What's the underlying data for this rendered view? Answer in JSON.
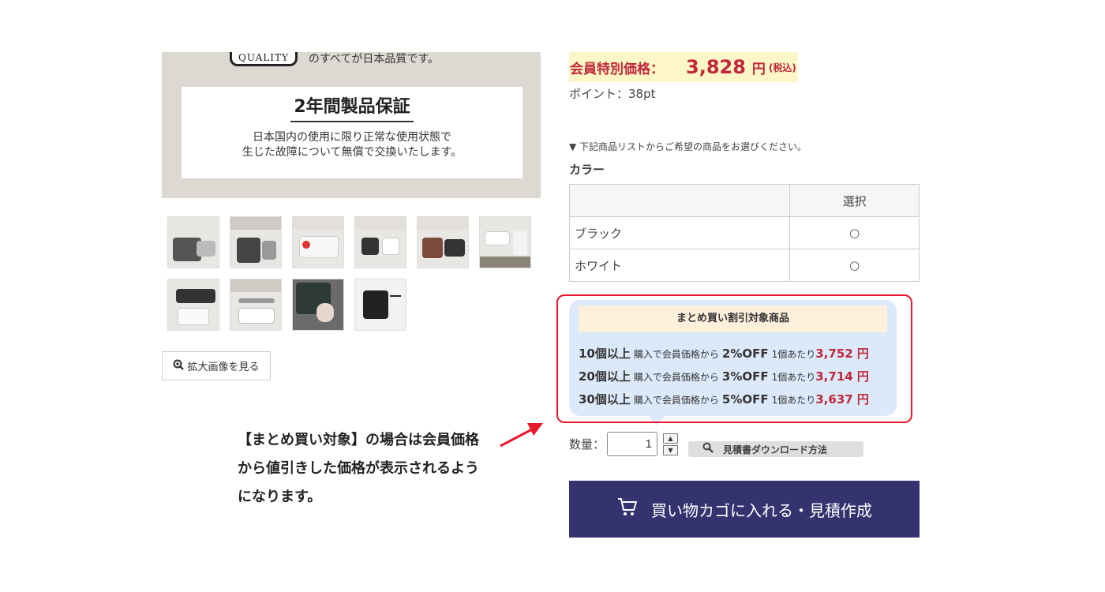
{
  "product_image": {
    "quality_badge": "QUALITY",
    "quality_text": "のすべてが日本品質です。",
    "warranty_title": "2年間製品保証",
    "warranty_line1": "日本国内の使用に限り正常な使用状態で",
    "warranty_line2": "生じた故障について無償で交換いたします。"
  },
  "zoom_button": "拡大画像を見る",
  "annotation": "【まとめ買い対象】の場合は会員価格から値引きした価格が表示されるようになります。",
  "price": {
    "label": "会員特別価格：",
    "value": "3,828",
    "unit": "円",
    "tax": "(税込)"
  },
  "points": "ポイント：38pt",
  "select_hint": "▼ 下記商品リストからご希望の商品をお選びください。",
  "color_label": "カラー",
  "color_table": {
    "header_select": "選択",
    "rows": [
      {
        "name": "ブラック",
        "mark": "○"
      },
      {
        "name": "ホワイト",
        "mark": "○"
      }
    ]
  },
  "bulk": {
    "header": "まとめ買い割引対象商品",
    "rows": [
      {
        "qty": "10個以上",
        "mid": "購入で会員価格から",
        "off": "2%OFF",
        "per": "1個あたり",
        "price": "3,752 円"
      },
      {
        "qty": "20個以上",
        "mid": "購入で会員価格から",
        "off": "3%OFF",
        "per": "1個あたり",
        "price": "3,714 円"
      },
      {
        "qty": "30個以上",
        "mid": "購入で会員価格から",
        "off": "5%OFF",
        "per": "1個あたり",
        "price": "3,637 円"
      }
    ]
  },
  "quantity": {
    "label": "数量：",
    "value": "1"
  },
  "estimate_button": "見積書ダウンロード方法",
  "cart_button": "買い物カゴに入れる・見積作成",
  "colors": {
    "price_red": "#c0283a",
    "cart_navy": "#343370",
    "bubble_blue": "#dce9fa",
    "frame_red": "#e8182a"
  }
}
